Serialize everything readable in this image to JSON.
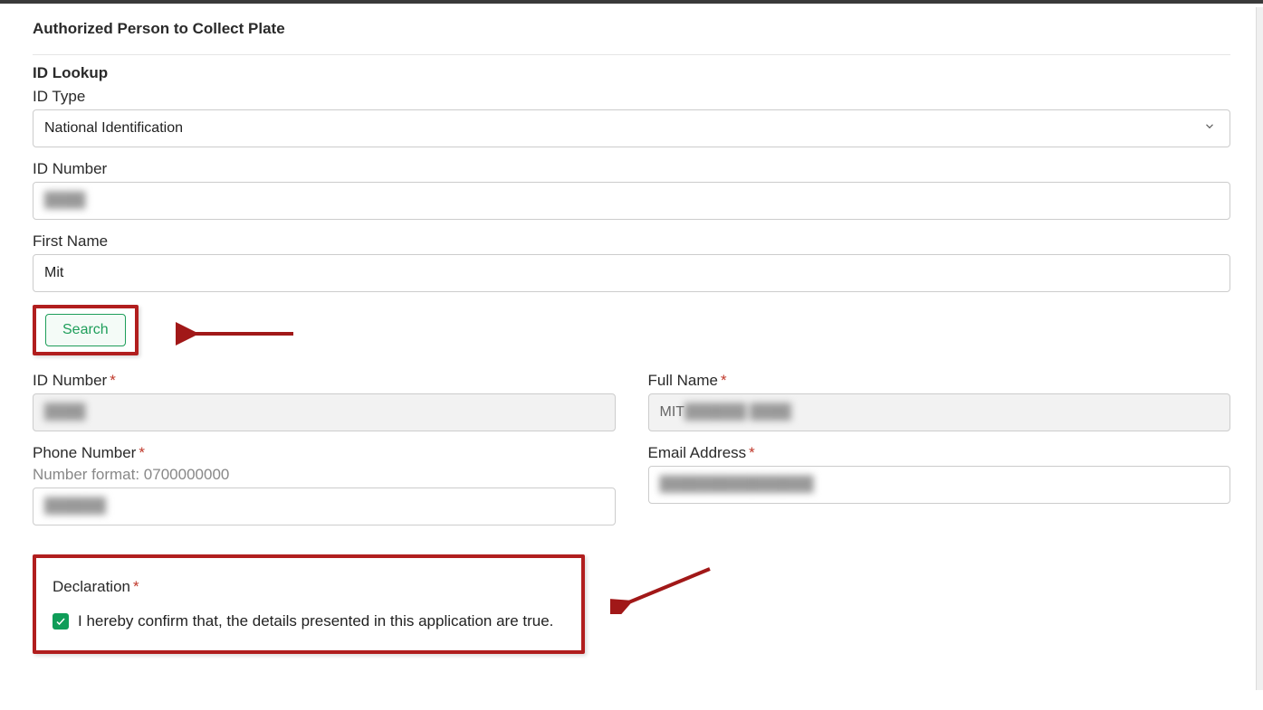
{
  "section_title": "Authorized Person to Collect Plate",
  "lookup": {
    "title": "ID Lookup",
    "id_type_label": "ID Type",
    "id_type_value": "National Identification",
    "id_number_label": "ID Number",
    "id_number_value": "████",
    "first_name_label": "First Name",
    "first_name_value": "Mit",
    "search_button": "Search"
  },
  "result": {
    "id_number_label": "ID Number",
    "id_number_value": "████",
    "full_name_label": "Full Name",
    "full_name_value_prefix": "MIT",
    "full_name_value_rest": " ██████ ████",
    "phone_label": "Phone Number",
    "phone_hint": "Number format: 0700000000",
    "phone_value": "██████",
    "email_label": "Email Address",
    "email_value": "███████████████"
  },
  "declaration": {
    "label": "Declaration",
    "text": "I hereby confirm that, the details presented in this application are true.",
    "checked": true
  },
  "required_marker": "*"
}
